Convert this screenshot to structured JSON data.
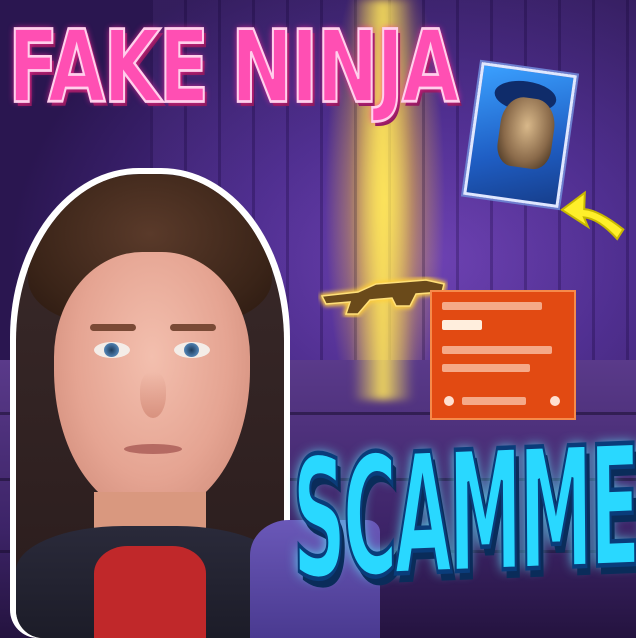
{
  "thumbnail": {
    "title": "FAKE NINJA",
    "caption": "SCAMMER!",
    "colors": {
      "title": "#ff4fb3",
      "caption": "#29d8ff",
      "background": "#4a2a8a",
      "light_beam": "#ffe45a",
      "arrow": "#ffef2a",
      "info_card": "#e24a12",
      "skin_card": "#1f5ec4"
    },
    "icons": {
      "arrow": "arrow-up-right-icon",
      "weapon": "rifle-icon"
    }
  }
}
